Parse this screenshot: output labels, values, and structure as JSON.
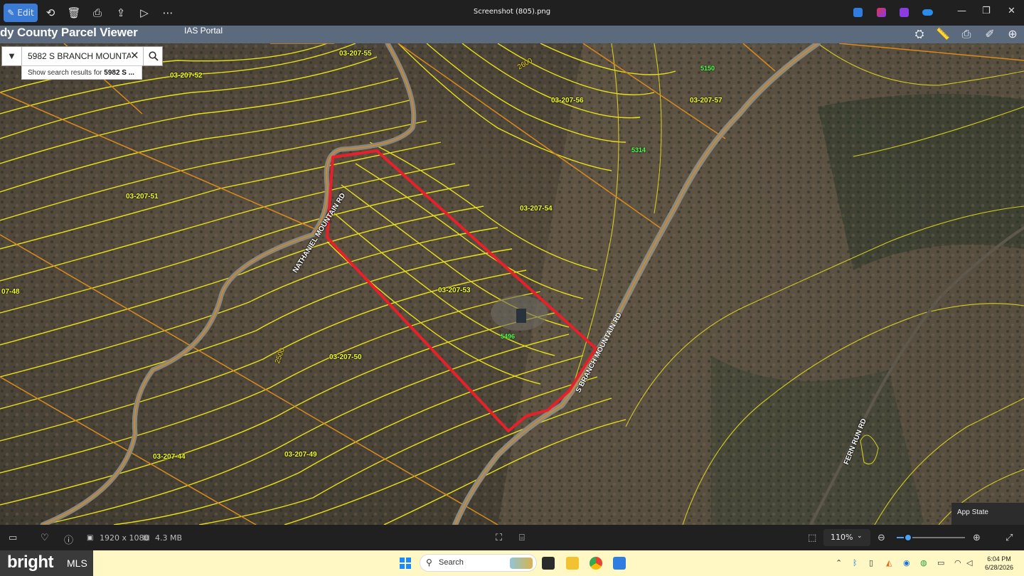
{
  "window": {
    "title": "Screenshot (805).png",
    "edit_label": "Edit",
    "toolbar_icons": [
      "rotate-icon",
      "delete-icon",
      "print-icon",
      "share-icon",
      "slideshow-icon",
      "more-icon"
    ]
  },
  "viewer": {
    "brand": "dy County Parcel Viewer",
    "portal_link": "IAS Portal"
  },
  "search": {
    "value": "5982 S BRANCH MOUNTA",
    "suggestion_prefix": "Show search results for ",
    "suggestion_bold": "5982 S ..."
  },
  "map": {
    "parcels": [
      {
        "id": "03-207-55"
      },
      {
        "id": "03-207-52"
      },
      {
        "id": "03-207-56"
      },
      {
        "id": "03-207-57"
      },
      {
        "id": "03-207-51"
      },
      {
        "id": "03-207-54"
      },
      {
        "id": "03-207-53"
      },
      {
        "id": "07-48"
      },
      {
        "id": "03-207-50"
      },
      {
        "id": "03-207-44"
      },
      {
        "id": "03-207-49"
      }
    ],
    "addresses": [
      "5150",
      "5314",
      "5496"
    ],
    "roads": [
      "NATHANIEL MOUNTAIN RD",
      "S BRANCH MOUNTAIN RD",
      "FERN RUN RD"
    ],
    "contours": [
      "2600",
      "2500"
    ],
    "colors": {
      "highlight": "#e8202a",
      "parcel_line": "#d98a1f",
      "contour": "#f0e81a",
      "address": "#4dff4d"
    }
  },
  "app_state": "App State",
  "status": {
    "dimensions": "1920 x 1080",
    "size": "4.3 MB",
    "zoom": "110%",
    "zoom_fraction": 0.17
  },
  "taskbar": {
    "logo": "bright",
    "logo_suffix": "MLS",
    "search_label": "Search",
    "time": "6:04 PM",
    "date": "6/28/2026"
  }
}
